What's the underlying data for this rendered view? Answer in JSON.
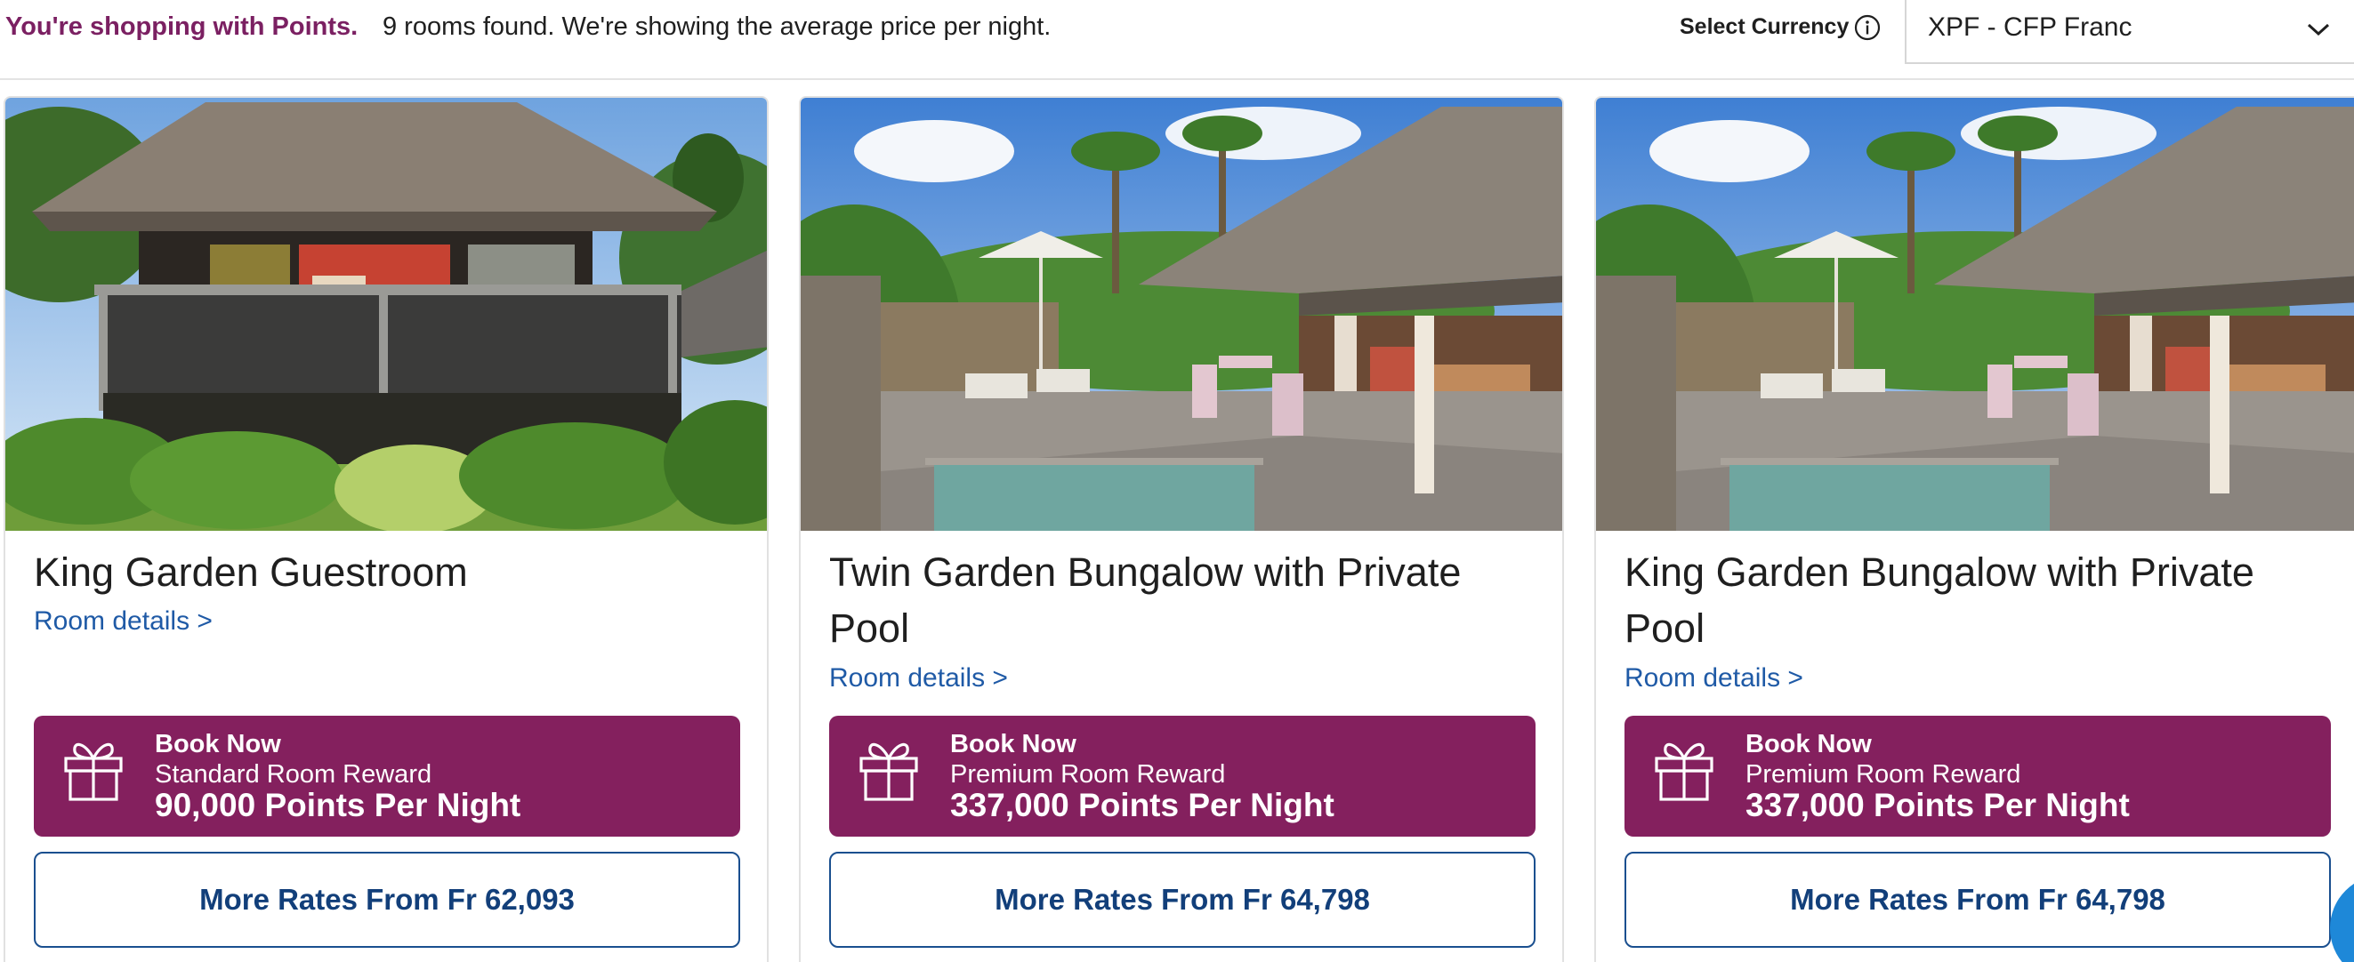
{
  "header": {
    "points_message": "You're shopping with Points.",
    "rooms_message": "9 rooms found. We're showing the average price per night.",
    "currency_label": "Select Currency",
    "currency_value": "XPF - CFP Franc"
  },
  "cards": [
    {
      "title": "King Garden Guestroom",
      "details_link": "Room details >",
      "book": {
        "label": "Book Now",
        "reward_type": "Standard Room Reward",
        "points": "90,000 Points Per Night"
      },
      "more_rates": "More Rates From Fr 62,093"
    },
    {
      "title": "Twin Garden Bungalow with Private Pool",
      "details_link": "Room details >",
      "book": {
        "label": "Book Now",
        "reward_type": "Premium Room Reward",
        "points": "337,000 Points Per Night"
      },
      "more_rates": "More Rates From Fr 64,798"
    },
    {
      "title": "King Garden Bungalow with Private Pool",
      "details_link": "Room details >",
      "book": {
        "label": "Book Now",
        "reward_type": "Premium Room Reward",
        "points": "337,000 Points Per Night"
      },
      "more_rates": "More Rates From Fr 64,798"
    }
  ],
  "colors": {
    "brand_plum": "#84205e",
    "points_text": "#7b2062",
    "link_blue": "#1f5aa6",
    "chat_blue": "#1e88d8"
  },
  "icons": [
    "info-icon",
    "chevron-down-icon",
    "gift-icon",
    "chat-icon"
  ]
}
